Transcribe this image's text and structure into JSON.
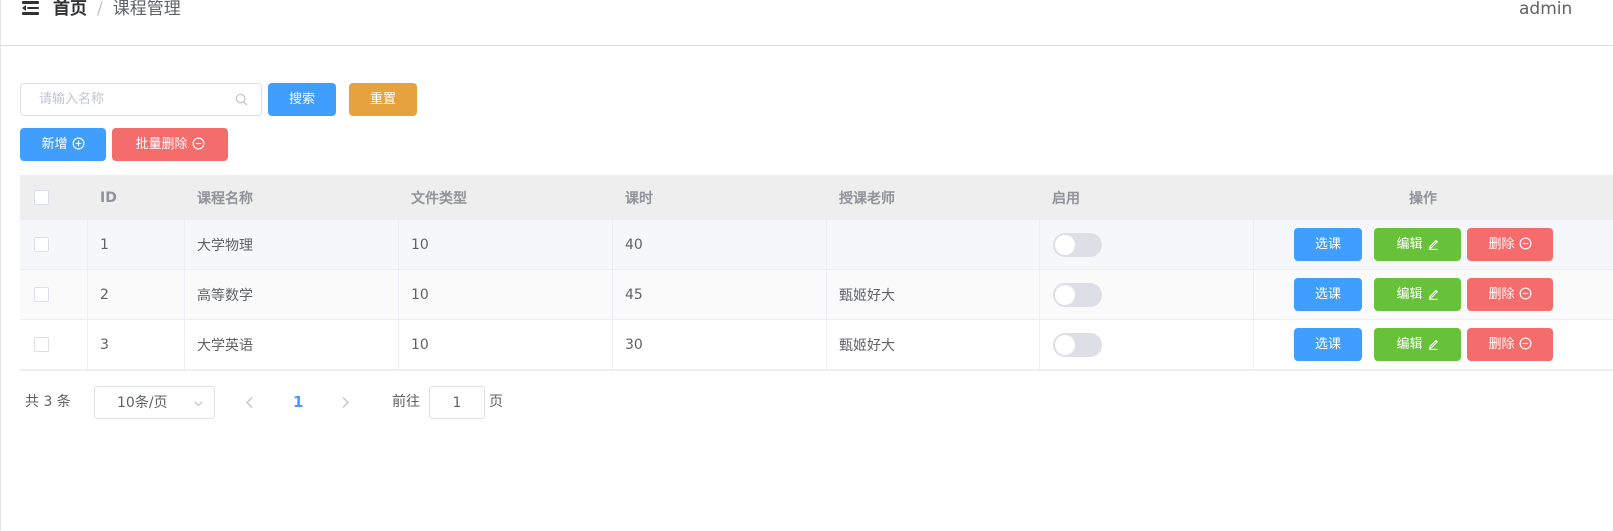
{
  "header": {
    "breadcrumb_home": "首页",
    "breadcrumb_separator": "/",
    "breadcrumb_current": "课程管理",
    "user": "admin"
  },
  "toolbar": {
    "search_placeholder": "请输入名称",
    "search_value": "",
    "search_label": "搜索",
    "reset_label": "重置",
    "add_label": "新增",
    "batch_delete_label": "批量删除"
  },
  "table": {
    "columns": {
      "id": "ID",
      "name": "课程名称",
      "file_type": "文件类型",
      "hours": "课时",
      "teacher": "授课老师",
      "enabled": "启用",
      "actions": "操作"
    },
    "rows": [
      {
        "id": "1",
        "name": "大学物理",
        "file_type": "10",
        "hours": "40",
        "teacher": "",
        "enabled": false
      },
      {
        "id": "2",
        "name": "高等数学",
        "file_type": "10",
        "hours": "45",
        "teacher": "甄姬好大",
        "enabled": false
      },
      {
        "id": "3",
        "name": "大学英语",
        "file_type": "10",
        "hours": "30",
        "teacher": "甄姬好大",
        "enabled": false
      }
    ],
    "action_labels": {
      "select": "选课",
      "edit": "编辑",
      "delete": "删除"
    }
  },
  "pagination": {
    "total_text": "共 3 条",
    "page_size": "10条/页",
    "current_page": "1",
    "goto_label": "前往",
    "goto_value": "1",
    "page_suffix": "页"
  },
  "colors": {
    "primary": "#409eff",
    "success": "#67c23a",
    "warning": "#e6a23c",
    "danger": "#f56c6c"
  }
}
